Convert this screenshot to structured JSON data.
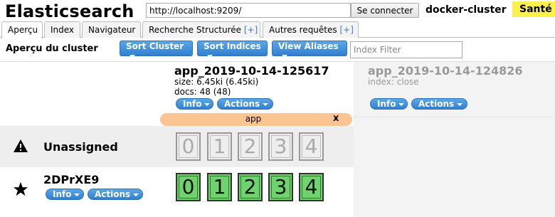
{
  "header": {
    "app_title": "Elasticsearch",
    "url_value": "http://localhost:9209/",
    "connect_label": "Se connecter",
    "cluster_name": "docker-cluster",
    "health_label": "Santé",
    "health_color": "#fbf04c"
  },
  "tabs": [
    {
      "label": "Aperçu",
      "plus": ""
    },
    {
      "label": "Index",
      "plus": ""
    },
    {
      "label": "Navigateur",
      "plus": ""
    },
    {
      "label": "Recherche Structurée",
      "plus": "[+]"
    },
    {
      "label": "Autres requêtes",
      "plus": "[+]"
    }
  ],
  "toolbar": {
    "title": "Aperçu du cluster",
    "sort_cluster": "Sort Cluster",
    "sort_indices": "Sort Indices",
    "view_aliases": "View Aliases",
    "index_filter_placeholder": "Index Filter"
  },
  "indices": [
    {
      "name": "app_2019-10-14-125617",
      "size": "size: 6.45ki (6.45ki)",
      "docs": "docs: 48 (48)",
      "info_label": "Info",
      "actions_label": "Actions"
    },
    {
      "name": "app_2019-10-14-124826",
      "status": "index: close",
      "info_label": "Info",
      "actions_label": "Actions"
    }
  ],
  "alias": {
    "name": "app",
    "remove": "x"
  },
  "rows": {
    "unassigned": {
      "label": "Unassigned",
      "icon": "warning-icon",
      "shards": [
        "0",
        "1",
        "2",
        "3",
        "4"
      ]
    },
    "node": {
      "label": "2DPrXE9",
      "icon": "star-icon",
      "info_label": "Info",
      "actions_label": "Actions",
      "shards": [
        "0",
        "1",
        "2",
        "3",
        "4"
      ]
    }
  },
  "colors": {
    "accent": "#2f80d0",
    "alias_bar": "#fbc593",
    "shard_started": "#6fd26f",
    "shard_unassigned": "#eeeeee"
  }
}
